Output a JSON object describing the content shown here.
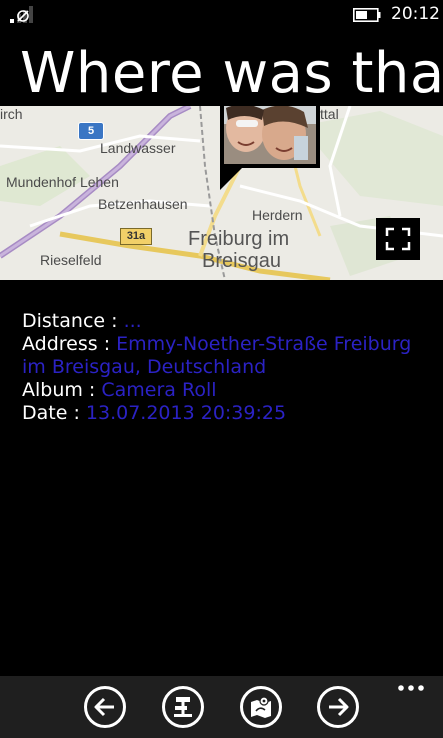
{
  "status_bar": {
    "time": "20:12"
  },
  "page": {
    "title": "Where was that"
  },
  "map": {
    "labels": {
      "landwasser": "Landwasser",
      "mundenhof": "Mundenhof Lehen",
      "betzenhausen": "Betzenhausen",
      "herdern": "Herdern",
      "rieselfeld": "Rieselfeld",
      "city_line1": "Freiburg im",
      "city_line2": "Breisgau",
      "urch": "irch",
      "ttal": "ttal",
      "route_5": "5",
      "route_31a": "31a"
    }
  },
  "details": {
    "distance_key": "Distance : ",
    "distance_value": "...",
    "address_key": "Address : ",
    "address_value": "Emmy-Noether-Straße Freiburg im Breisgau, Deutschland",
    "album_key": "Album : ",
    "album_value": "Camera Roll",
    "date_key": "Date : ",
    "date_value": "13.07.2013 20:39:25"
  },
  "app_bar": {
    "more": "..."
  }
}
